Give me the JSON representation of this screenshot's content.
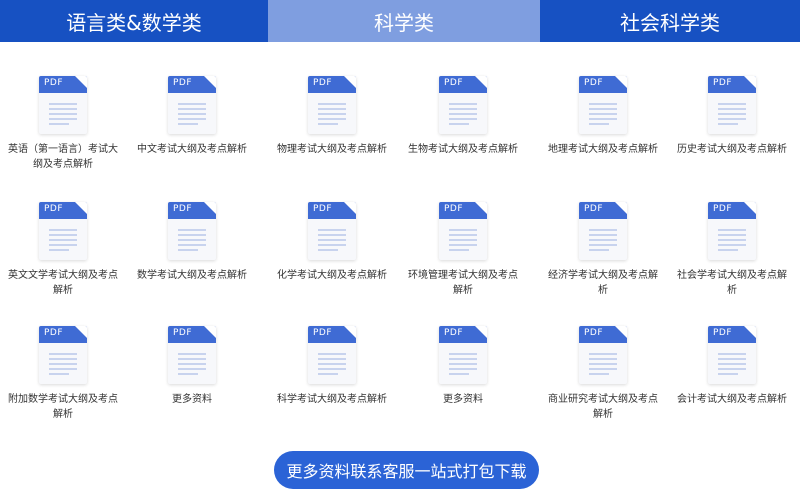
{
  "tabs": [
    "语言类&数学类",
    "科学类",
    "社会科学类"
  ],
  "active_tab": 1,
  "icon_tag": "PDF",
  "rows": [
    [
      "英语（第一语言）考试大纲及考点解析",
      "中文考试大纲及考点解析",
      "物理考试大纲及考点解析",
      "生物考试大纲及考点解析",
      "地理考试大纲及考点解析",
      "历史考试大纲及考点解析"
    ],
    [
      "英文文学考试大纲及考点解析",
      "数学考试大纲及考点解析",
      "化学考试大纲及考点解析",
      "环境管理考试大纲及考点解析",
      "经济学考试大纲及考点解析",
      "社会学考试大纲及考点解析"
    ],
    [
      "附加数学考试大纲及考点解析",
      "更多资料",
      "科学考试大纲及考点解析",
      "更多资料",
      "商业研究考试大纲及考点解析",
      "会计考试大纲及考点解析"
    ]
  ],
  "download_button": "更多资料联系客服一站式打包下载",
  "colors": {
    "tab_bg": "#1751c2",
    "tab_active_bg": "#7f9ee0",
    "button_bg": "#2b63d6",
    "pdf_band": "#3f6bd4"
  }
}
